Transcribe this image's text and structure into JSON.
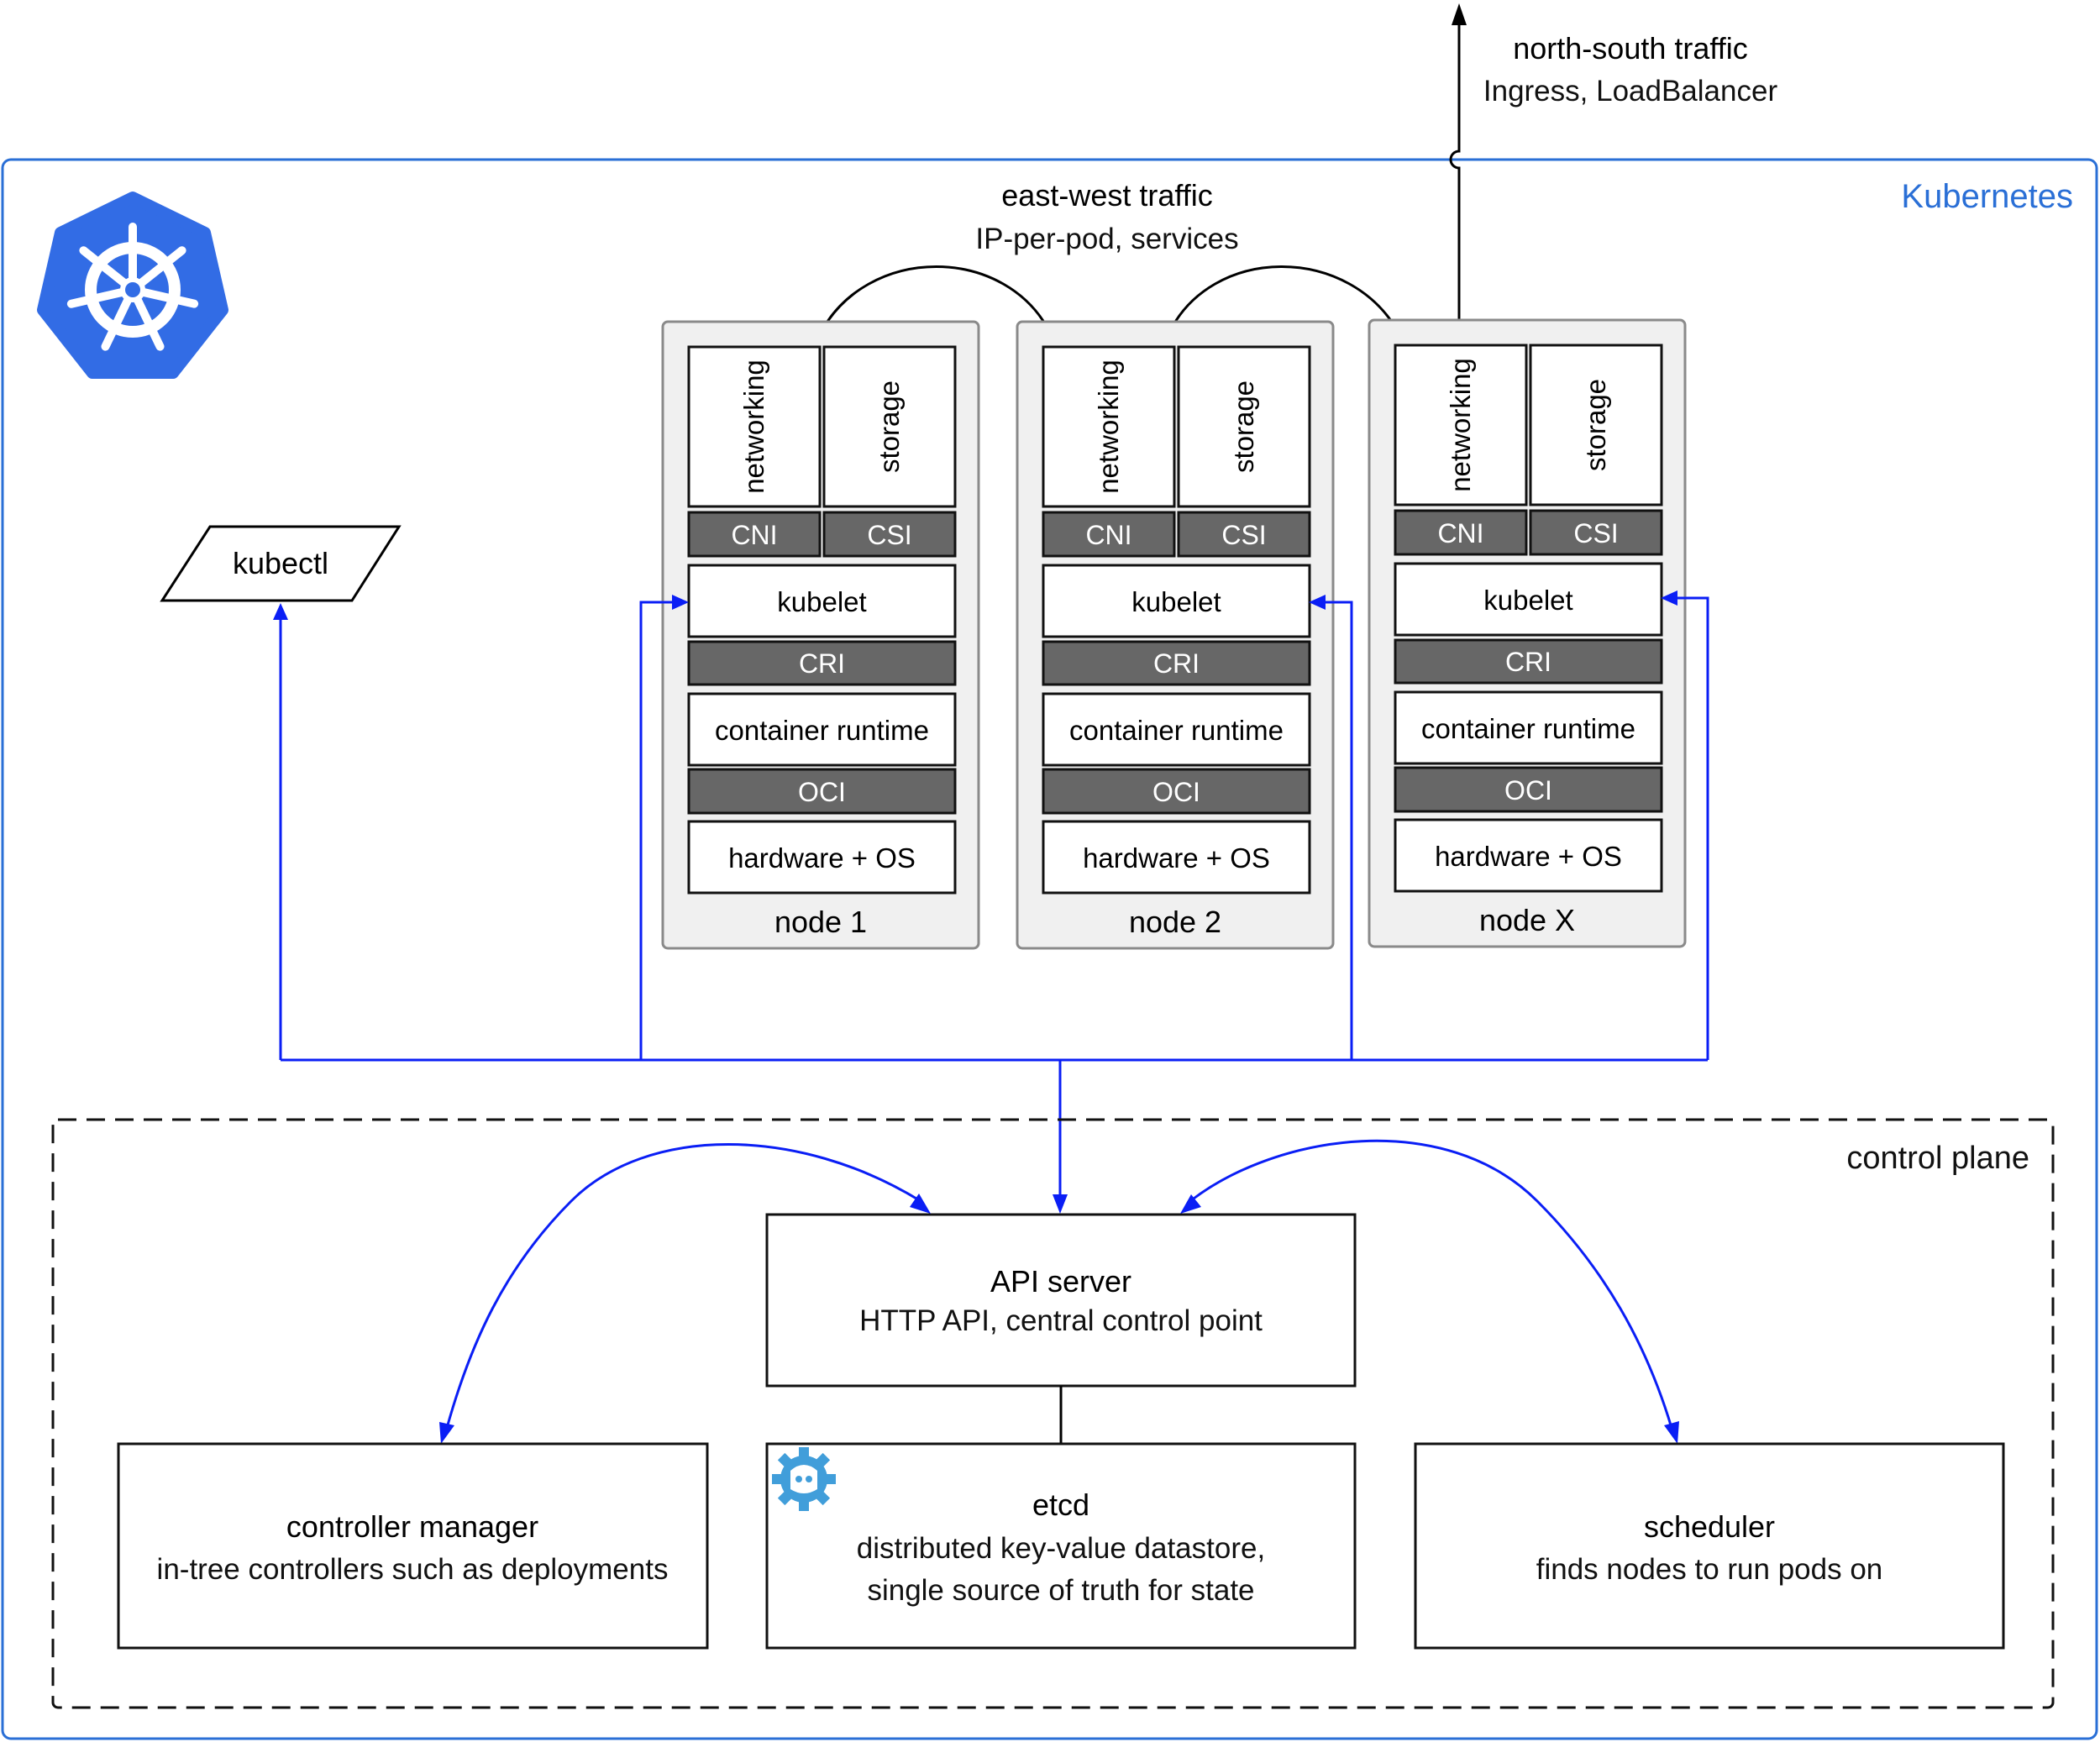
{
  "cluster": {
    "label": "Kubernetes",
    "border_color": "#2a6fd6",
    "logo": "kubernetes-helm-icon"
  },
  "north_south": {
    "title": "north-south traffic",
    "subtitle": "Ingress, LoadBalancer"
  },
  "east_west": {
    "title": "east-west traffic",
    "subtitle": "IP-per-pod, services"
  },
  "kubectl": {
    "label": "kubectl"
  },
  "node_layers": {
    "networking": "networking",
    "storage": "storage",
    "cni": "CNI",
    "csi": "CSI",
    "kubelet": "kubelet",
    "cri": "CRI",
    "container_runtime": "container runtime",
    "oci": "OCI",
    "hardware": "hardware + OS"
  },
  "nodes": [
    {
      "name": "node 1"
    },
    {
      "name": "node 2"
    },
    {
      "name": "node X"
    }
  ],
  "control_plane": {
    "label": "control plane",
    "api_server": {
      "title": "API server",
      "subtitle": "HTTP API, central control point"
    },
    "controller_manager": {
      "title": "controller manager",
      "subtitle": "in-tree controllers such as deployments"
    },
    "etcd": {
      "title": "etcd",
      "subtitle_line1": "distributed key-value datastore,",
      "subtitle_line2": "single source of truth for state",
      "icon": "etcd-icon"
    },
    "scheduler": {
      "title": "scheduler",
      "subtitle": "finds nodes to run pods on"
    }
  },
  "colors": {
    "api_links": "#0a1ef5",
    "traffic_links": "#000000",
    "interface_fill": "#676767",
    "node_fill": "#f0f0f0",
    "k8s_blue": "#326ce5",
    "etcd_blue": "#419eda"
  }
}
